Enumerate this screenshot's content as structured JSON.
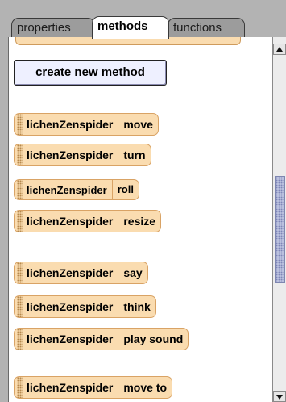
{
  "tabs": [
    {
      "label": "properties",
      "active": false
    },
    {
      "label": "methods",
      "active": true
    },
    {
      "label": "functions",
      "active": false
    }
  ],
  "create_button": {
    "label": "create new method"
  },
  "method_tiles": [
    {
      "object": "lichenZenspider",
      "method": "move"
    },
    {
      "object": "lichenZenspider",
      "method": "turn"
    },
    {
      "object": "lichenZenspider",
      "method": "roll"
    },
    {
      "object": "lichenZenspider",
      "method": "resize"
    },
    {
      "object": "lichenZenspider",
      "method": "say"
    },
    {
      "object": "lichenZenspider",
      "method": "think"
    },
    {
      "object": "lichenZenspider",
      "method": "play sound"
    },
    {
      "object": "lichenZenspider",
      "method": "move to"
    }
  ],
  "colors": {
    "tile_fill": "#fadcb0",
    "tile_border": "#d9a365",
    "button_fill": "#eef0ff",
    "scroll_thumb": "#c7cde6"
  }
}
